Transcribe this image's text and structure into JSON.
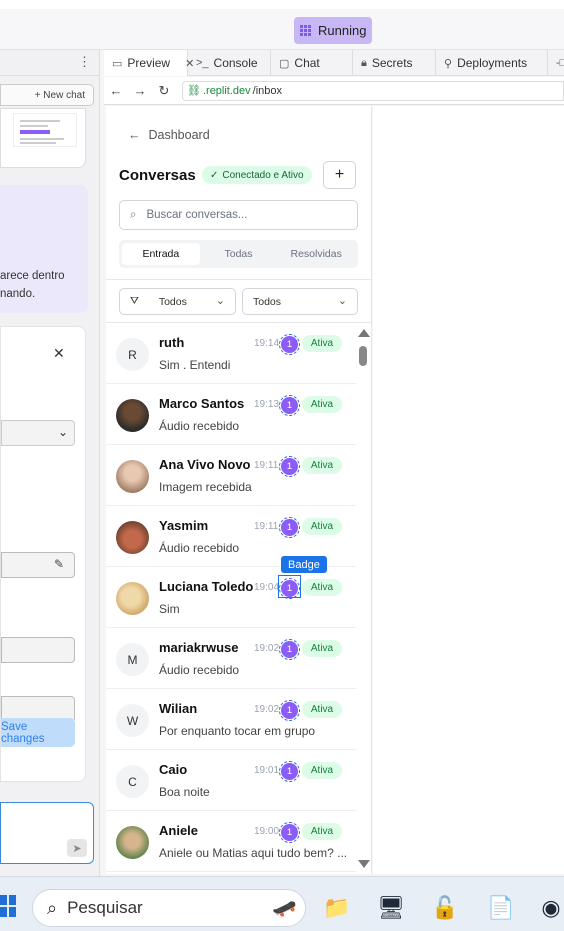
{
  "window": {
    "run_status": "Running"
  },
  "left_panel": {
    "new_chat_label": "+ New chat",
    "partial_text_line1": "arece dentro",
    "partial_text_line2": "nando.",
    "save_label": "Save changes"
  },
  "tabs": [
    {
      "label": "Preview",
      "icon": "monitor-icon"
    },
    {
      "label": "Console",
      "icon": "terminal-icon"
    },
    {
      "label": "Chat",
      "icon": "chat-icon"
    },
    {
      "label": "Secrets",
      "icon": "lock-icon"
    },
    {
      "label": "Deployments",
      "icon": "deploy-icon"
    }
  ],
  "url": {
    "host": ".replit.dev",
    "path": "/inbox"
  },
  "app": {
    "back_label": "Dashboard",
    "title": "Conversas",
    "connection_status": "Conectado e Ativo",
    "search_placeholder": "Buscar conversas...",
    "segments": [
      "Entrada",
      "Todas",
      "Resolvidas"
    ],
    "active_segment": "Entrada",
    "filter1": "Todos",
    "filter2": "Todos",
    "tooltip": "Badge",
    "conversations": [
      {
        "name": "ruth",
        "initial": "R",
        "time": "19:14",
        "count": "1",
        "status": "Ativa",
        "preview": "Sim . Entendi"
      },
      {
        "name": "Marco Santos",
        "initial": "",
        "time": "19:13",
        "count": "1",
        "status": "Ativa",
        "preview": "Áudio recebido"
      },
      {
        "name": "Ana Vivo Novo",
        "initial": "",
        "time": "19:11",
        "count": "1",
        "status": "Ativa",
        "preview": "Imagem recebida"
      },
      {
        "name": "Yasmim",
        "initial": "",
        "time": "19:11",
        "count": "1",
        "status": "Ativa",
        "preview": "Áudio recebido"
      },
      {
        "name": "Luciana Toledo",
        "initial": "",
        "time": "19:04",
        "count": "1",
        "status": "Ativa",
        "preview": "Sim"
      },
      {
        "name": "mariakrwuse",
        "initial": "M",
        "time": "19:02",
        "count": "1",
        "status": "Ativa",
        "preview": "Áudio recebido"
      },
      {
        "name": "Wilian",
        "initial": "W",
        "time": "19:02",
        "count": "1",
        "status": "Ativa",
        "preview": "Por enquanto tocar em grupo"
      },
      {
        "name": "Caio",
        "initial": "C",
        "time": "19:01",
        "count": "1",
        "status": "Ativa",
        "preview": "Boa noite"
      },
      {
        "name": "Aniele",
        "initial": "",
        "time": "19:00",
        "count": "1",
        "status": "Ativa",
        "preview": "Aniele ou Matias aqui tudo bem? ..."
      }
    ]
  },
  "taskbar": {
    "search_label": "Pesquisar"
  },
  "colors": {
    "accent_purple": "#8b5cf6",
    "status_green": "#15803d",
    "link_blue": "#1a73e8"
  }
}
